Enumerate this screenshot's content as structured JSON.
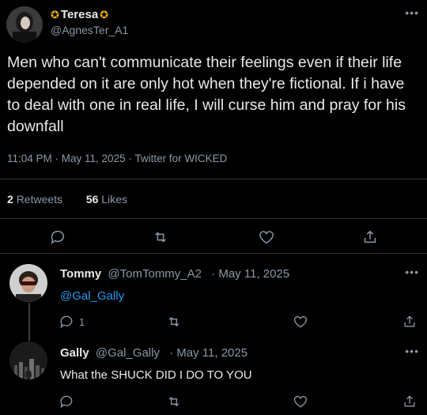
{
  "tweet": {
    "display_name": "Teresa",
    "handle": "@AgnesTer_A1",
    "text": "Men who can't communicate their feelings even if their life depended on it are only hot when they're fictional. If i have to deal with one in real life, I will curse him and pray for his downfall",
    "meta": "11:04 PM · May 11, 2025 · Twitter for WICKED",
    "retweets_count": "2",
    "retweets_label": "Retweets",
    "likes_count": "56",
    "likes_label": "Likes"
  },
  "replies": [
    {
      "display_name": "Tommy",
      "handle": "@TomTommy_A2",
      "date": "· May 11, 2025",
      "text": "@Gal_Gally",
      "reply_count": "1"
    },
    {
      "display_name": "Gally",
      "handle": "@Gal_Gally",
      "date": "· May 11, 2025",
      "text": "What the SHUCK DID I DO TO YOU"
    }
  ],
  "icons": [
    "reply-icon",
    "retweet-icon",
    "like-icon",
    "share-icon",
    "more-icon",
    "crown-emoji-icon"
  ],
  "colors": {
    "background": "#000000",
    "text": "#e7e9ea",
    "muted": "#8b98a5",
    "link": "#1d9bf0",
    "divider": "#2f3336"
  }
}
